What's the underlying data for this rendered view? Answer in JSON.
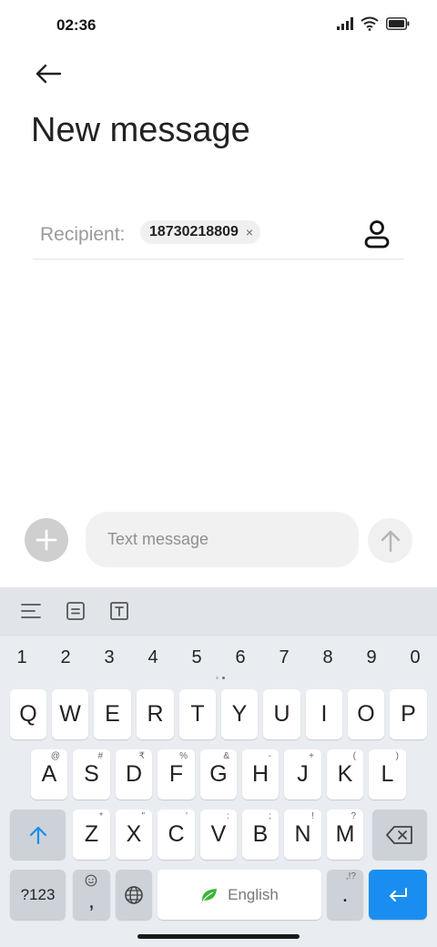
{
  "status_bar": {
    "time": "02:36"
  },
  "header": {
    "title": "New message"
  },
  "recipient": {
    "label": "Recipient:",
    "chip_number": "18730218809",
    "chip_remove": "×"
  },
  "composer": {
    "placeholder": "Text message"
  },
  "keyboard": {
    "numbers": [
      "1",
      "2",
      "3",
      "4",
      "5",
      "6",
      "7",
      "8",
      "9",
      "0"
    ],
    "row1": [
      {
        "k": "Q",
        "s": ""
      },
      {
        "k": "W",
        "s": ""
      },
      {
        "k": "E",
        "s": ""
      },
      {
        "k": "R",
        "s": ""
      },
      {
        "k": "T",
        "s": ""
      },
      {
        "k": "Y",
        "s": ""
      },
      {
        "k": "U",
        "s": ""
      },
      {
        "k": "I",
        "s": ""
      },
      {
        "k": "O",
        "s": ""
      },
      {
        "k": "P",
        "s": ""
      }
    ],
    "row2": [
      {
        "k": "A",
        "s": "@"
      },
      {
        "k": "S",
        "s": "#"
      },
      {
        "k": "D",
        "s": "₹"
      },
      {
        "k": "F",
        "s": "%"
      },
      {
        "k": "G",
        "s": "&"
      },
      {
        "k": "H",
        "s": "-"
      },
      {
        "k": "J",
        "s": "+"
      },
      {
        "k": "K",
        "s": "("
      },
      {
        "k": "L",
        "s": ")"
      }
    ],
    "row3": [
      {
        "k": "Z",
        "s": "*"
      },
      {
        "k": "X",
        "s": "\""
      },
      {
        "k": "C",
        "s": "'"
      },
      {
        "k": "V",
        "s": ":"
      },
      {
        "k": "B",
        "s": ";"
      },
      {
        "k": "N",
        "s": "!"
      },
      {
        "k": "M",
        "s": "?"
      }
    ],
    "symbols_label": "?123",
    "comma_label": ",",
    "space_label": "English",
    "period_label": ".",
    "period_sub": ",!?",
    "accent_color": "#1a8ef0"
  }
}
